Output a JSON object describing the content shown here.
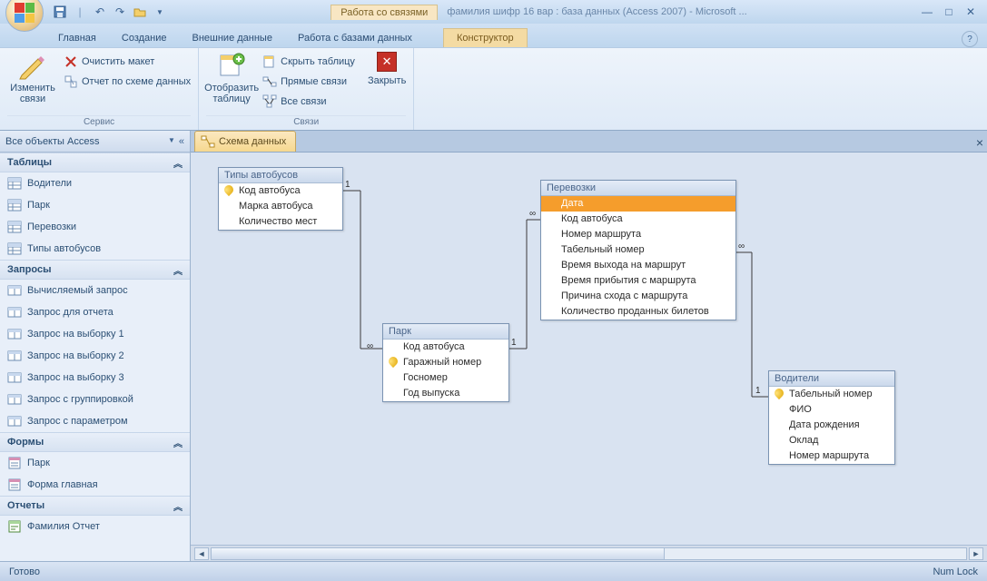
{
  "title": "фамилия шифр 16 вар : база данных (Access 2007) - Microsoft ...",
  "context_title": "Работа со связями",
  "tabs": {
    "home": "Главная",
    "create": "Создание",
    "external": "Внешние данные",
    "dbtools": "Работа с базами данных",
    "design": "Конструктор"
  },
  "ribbon": {
    "edit_rel": "Изменить связи",
    "clear_layout": "Очистить макет",
    "rel_report": "Отчет по схеме данных",
    "service": "Сервис",
    "show_table": "Отобразить таблицу",
    "hide_table": "Скрыть таблицу",
    "direct_rel": "Прямые связи",
    "all_rel": "Все связи",
    "close": "Закрыть",
    "relations": "Связи"
  },
  "nav": {
    "title": "Все объекты Access",
    "groups": {
      "tables": "Таблицы",
      "queries": "Запросы",
      "forms": "Формы",
      "reports": "Отчеты"
    },
    "tables": [
      "Водители",
      "Парк",
      "Перевозки",
      "Типы автобусов"
    ],
    "queries": [
      "Вычисляемый запрос",
      "Запрос для отчета",
      "Запрос на выборку 1",
      "Запрос на выборку 2",
      "Запрос на выборку 3",
      "Запрос с группировкой",
      "Запрос с параметром"
    ],
    "forms": [
      "Парк",
      "Форма главная"
    ],
    "reports": [
      "Фамилия Отчет"
    ]
  },
  "doc_tab": "Схема данных",
  "boxes": {
    "bus_types": {
      "title": "Типы автобусов",
      "fields": [
        "Код автобуса",
        "Марка автобуса",
        "Количество мест"
      ],
      "keys": [
        0
      ]
    },
    "park": {
      "title": "Парк",
      "fields": [
        "Код автобуса",
        "Гаражный номер",
        "Госномер",
        "Год выпуска"
      ],
      "keys": [
        1
      ]
    },
    "trips": {
      "title": "Перевозки",
      "fields": [
        "Дата",
        "Код автобуса",
        "Номер маршрута",
        "Табельный номер",
        "Время выхода на маршрут",
        "Время прибытия с маршрута",
        "Причина схода с маршрута",
        "Количество проданных билетов"
      ],
      "keys": [],
      "selected": 0
    },
    "drivers": {
      "title": "Водители",
      "fields": [
        "Табельный номер",
        "ФИО",
        "Дата рождения",
        "Оклад",
        "Номер маршрута"
      ],
      "keys": [
        0
      ]
    }
  },
  "status": {
    "ready": "Готово",
    "numlock": "Num Lock"
  }
}
